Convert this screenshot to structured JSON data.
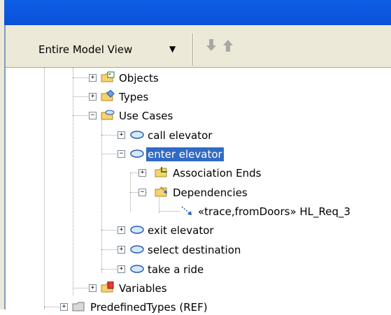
{
  "toolbar": {
    "view_select": "Entire Model View",
    "down_button": "down-arrow-icon",
    "up_button": "up-arrow-icon"
  },
  "tree": {
    "items": [
      {
        "label": "Objects",
        "icon": "folder-objects-icon"
      },
      {
        "label": "Types",
        "icon": "folder-types-icon"
      },
      {
        "label": "Use Cases",
        "icon": "folder-use-cases-icon"
      },
      {
        "label": "call elevator",
        "icon": "use-case-icon"
      },
      {
        "label": "enter elevator",
        "icon": "use-case-icon",
        "selected": true
      },
      {
        "label": "Association Ends",
        "icon": "folder-association-ends-icon"
      },
      {
        "label": "Dependencies",
        "icon": "folder-dependencies-icon"
      },
      {
        "label": "«trace,fromDoors» HL_Req_3",
        "icon": "dependency-icon"
      },
      {
        "label": "exit elevator",
        "icon": "use-case-icon"
      },
      {
        "label": "select destination",
        "icon": "use-case-icon"
      },
      {
        "label": "take a ride",
        "icon": "use-case-icon"
      },
      {
        "label": "Variables",
        "icon": "folder-variables-icon"
      },
      {
        "label": "PredefinedTypes (REF)",
        "icon": "folder-icon"
      }
    ]
  },
  "colors": {
    "titlebar": "#0950d8",
    "selection": "#316ac5",
    "toolbar_bg": "#ece9d8"
  }
}
